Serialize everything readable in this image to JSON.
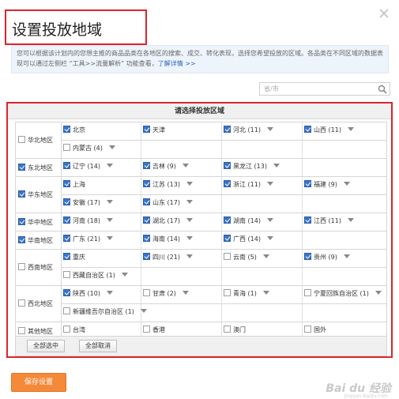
{
  "dialog": {
    "title": "设置投放地域",
    "info_text": "您可以根据该计划内的您想主推的商品品类在各地区的搜索、成交、转化表现，选择您希望投放的区域。各品类在不同区域的数据表现可以通过左侧栏 “工具>>流量解析” 功能查看，",
    "info_link": "了解详情 >>",
    "search_placeholder": "省/市",
    "table_header": "请选择投放区域",
    "select_all_label": "全部选中",
    "deselect_all_label": "全部取消",
    "save_label": "保存设置"
  },
  "regions": [
    {
      "label": "华北地区",
      "checked": false,
      "rows": [
        [
          {
            "name": "北京",
            "checked": true,
            "dropdown": false
          },
          {
            "name": "天津",
            "checked": true,
            "dropdown": false
          },
          {
            "name": "河北 (11)",
            "checked": true,
            "dropdown": true
          },
          {
            "name": "山西 (11)",
            "checked": true,
            "dropdown": true
          }
        ],
        [
          {
            "name": "内蒙古 (4)",
            "checked": false,
            "dropdown": true
          }
        ]
      ]
    },
    {
      "label": "东北地区",
      "checked": true,
      "rows": [
        [
          {
            "name": "辽宁 (14)",
            "checked": true,
            "dropdown": true
          },
          {
            "name": "吉林 (9)",
            "checked": true,
            "dropdown": true
          },
          {
            "name": "黑龙江 (13)",
            "checked": true,
            "dropdown": true
          }
        ]
      ]
    },
    {
      "label": "华东地区",
      "checked": true,
      "rows": [
        [
          {
            "name": "上海",
            "checked": true,
            "dropdown": false
          },
          {
            "name": "江苏 (13)",
            "checked": true,
            "dropdown": true
          },
          {
            "name": "浙江 (11)",
            "checked": true,
            "dropdown": true
          },
          {
            "name": "福建 (9)",
            "checked": true,
            "dropdown": true
          }
        ],
        [
          {
            "name": "安徽 (17)",
            "checked": true,
            "dropdown": true
          },
          {
            "name": "山东 (17)",
            "checked": true,
            "dropdown": true
          }
        ]
      ]
    },
    {
      "label": "华中地区",
      "checked": true,
      "rows": [
        [
          {
            "name": "河南 (18)",
            "checked": true,
            "dropdown": true
          },
          {
            "name": "湖北 (17)",
            "checked": true,
            "dropdown": true
          },
          {
            "name": "湖南 (14)",
            "checked": true,
            "dropdown": true
          },
          {
            "name": "江西 (11)",
            "checked": true,
            "dropdown": true
          }
        ]
      ]
    },
    {
      "label": "华南地区",
      "checked": true,
      "rows": [
        [
          {
            "name": "广东 (21)",
            "checked": true,
            "dropdown": true
          },
          {
            "name": "海南 (14)",
            "checked": true,
            "dropdown": true
          },
          {
            "name": "广西 (14)",
            "checked": true,
            "dropdown": true
          }
        ]
      ]
    },
    {
      "label": "西南地区",
      "checked": false,
      "rows": [
        [
          {
            "name": "重庆",
            "checked": true,
            "dropdown": false
          },
          {
            "name": "四川 (21)",
            "checked": true,
            "dropdown": true
          },
          {
            "name": "云南 (5)",
            "checked": false,
            "dropdown": true
          },
          {
            "name": "贵州 (9)",
            "checked": true,
            "dropdown": true
          }
        ],
        [
          {
            "name": "西藏自治区 (1)",
            "checked": false,
            "dropdown": true
          }
        ]
      ]
    },
    {
      "label": "西北地区",
      "checked": false,
      "rows": [
        [
          {
            "name": "陕西 (10)",
            "checked": true,
            "dropdown": true
          },
          {
            "name": "甘肃 (2)",
            "checked": false,
            "dropdown": true
          },
          {
            "name": "青海 (1)",
            "checked": false,
            "dropdown": true
          },
          {
            "name": "宁夏回族自治区 (1)",
            "checked": false,
            "dropdown": true
          }
        ],
        [
          {
            "name": "新疆维吾尔自治区 (1)",
            "checked": false,
            "dropdown": true
          }
        ]
      ]
    },
    {
      "label": "其他地区",
      "checked": false,
      "rows": [
        [
          {
            "name": "台湾",
            "checked": false,
            "dropdown": false
          },
          {
            "name": "香港",
            "checked": false,
            "dropdown": false
          },
          {
            "name": "澳门",
            "checked": false,
            "dropdown": false
          },
          {
            "name": "国外",
            "checked": false,
            "dropdown": false
          }
        ]
      ]
    }
  ],
  "watermark": {
    "text": "Bai du 经验",
    "sub": "jingyan.baidu.com"
  },
  "colors": {
    "accent_red": "#d9252c",
    "checkbox_blue": "#3a74c9",
    "save_orange": "#f5893a",
    "link_blue": "#2a66c6"
  }
}
